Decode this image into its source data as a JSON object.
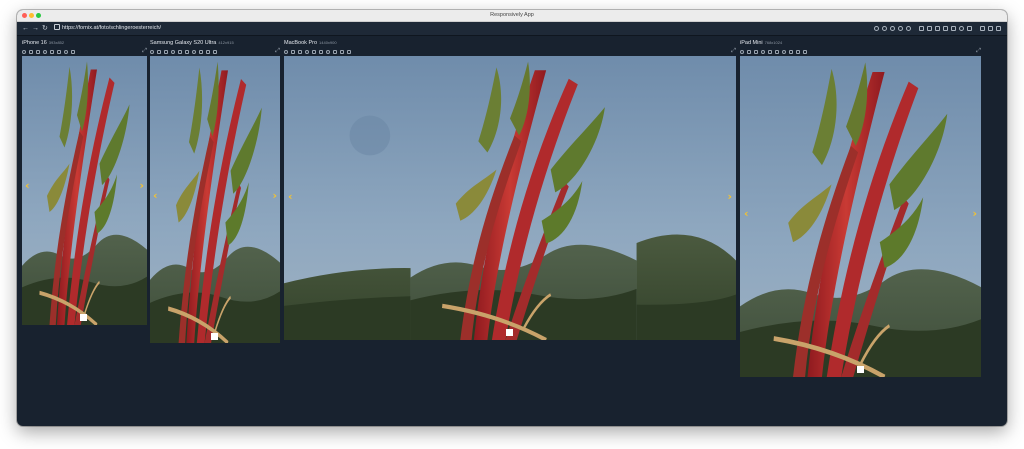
{
  "window": {
    "title": "Responsively App"
  },
  "address_bar": {
    "url": "https://fornix.at/foto/schlingeroesterreich/"
  },
  "devices": [
    {
      "name": "iPhone 16",
      "dims": "393x852"
    },
    {
      "name": "Samsung Galaxy S20 Ultra",
      "dims": "412x915"
    },
    {
      "name": "MacBook Pro",
      "dims": "1440x900"
    },
    {
      "name": "iPad Mini",
      "dims": "768x1024"
    }
  ],
  "gallery": {
    "prev_icon": "‹",
    "next_icon": "›"
  },
  "colors": {
    "app_background": "#18222f",
    "arrow": "#f2c232",
    "stem": "#b8262a",
    "sky": "#7f9ab4"
  }
}
